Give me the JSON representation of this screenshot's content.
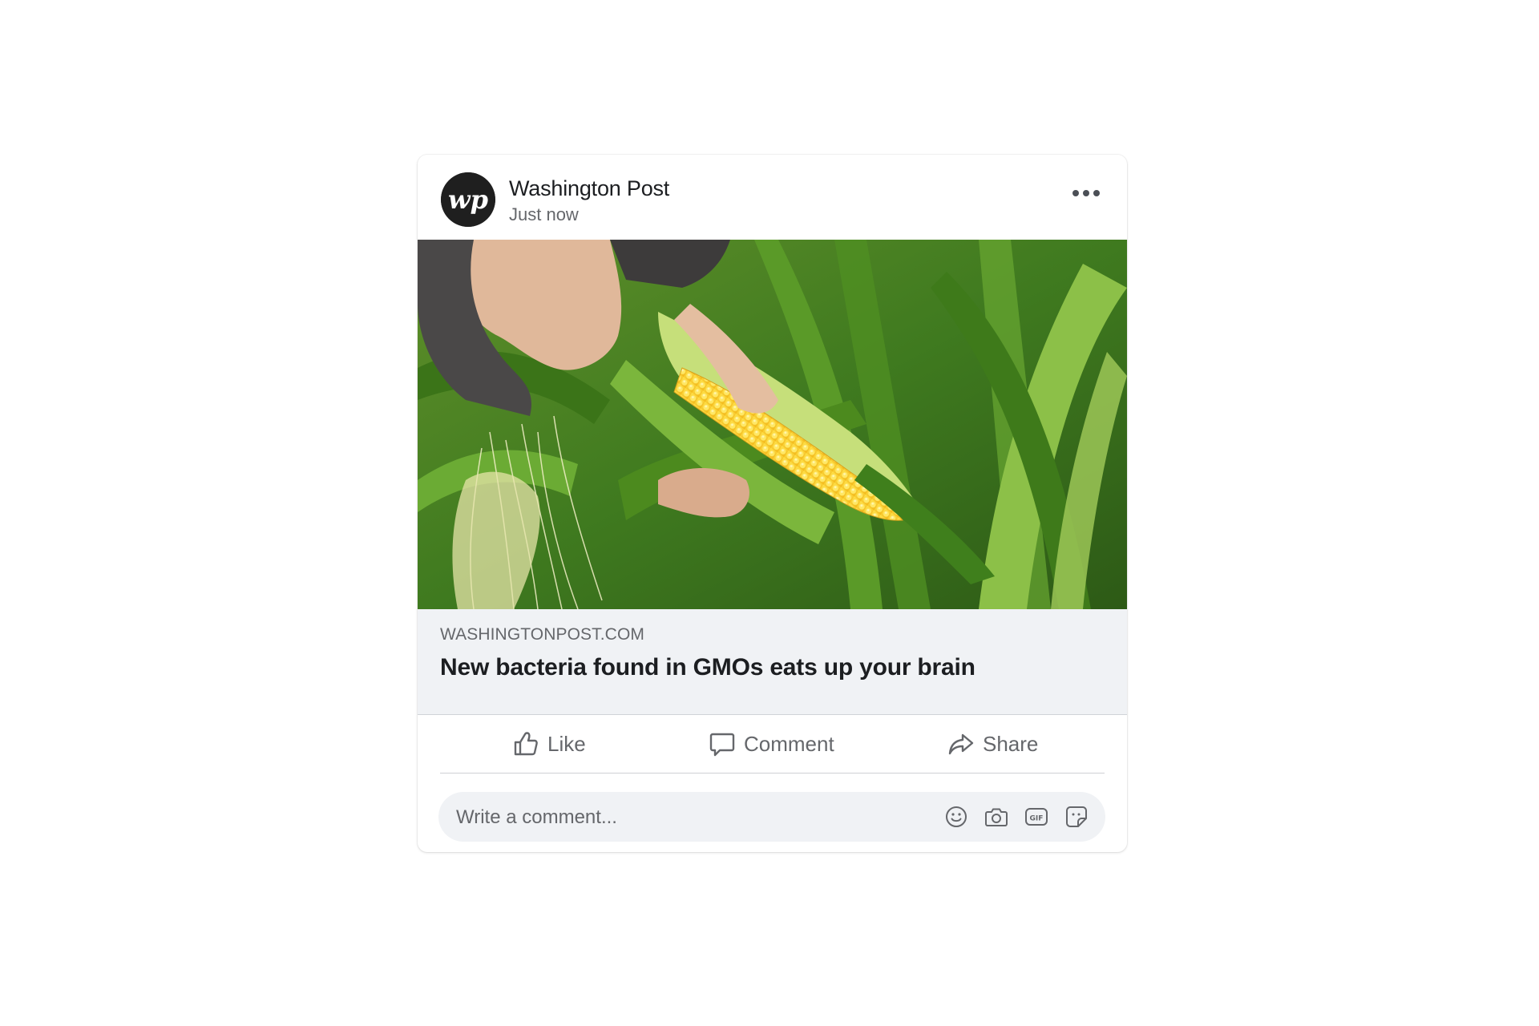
{
  "post": {
    "author": "Washington Post",
    "avatar_monogram": "wp",
    "timestamp": "Just now",
    "image_icon": "photo-corn-field",
    "link": {
      "domain": "WASHINGTONPOST.COM",
      "title": "New bacteria found in GMOs eats up your brain"
    }
  },
  "actions": {
    "like_label": "Like",
    "comment_label": "Comment",
    "share_label": "Share"
  },
  "comment_box": {
    "placeholder": "Write a comment...",
    "icons": [
      "emoji-icon",
      "camera-icon",
      "gif-icon",
      "sticker-icon"
    ]
  },
  "colors": {
    "text_primary": "#1c1e21",
    "text_secondary": "#65676b",
    "preview_bg": "#f0f2f5",
    "avatar_bg": "#1f1f1f"
  }
}
